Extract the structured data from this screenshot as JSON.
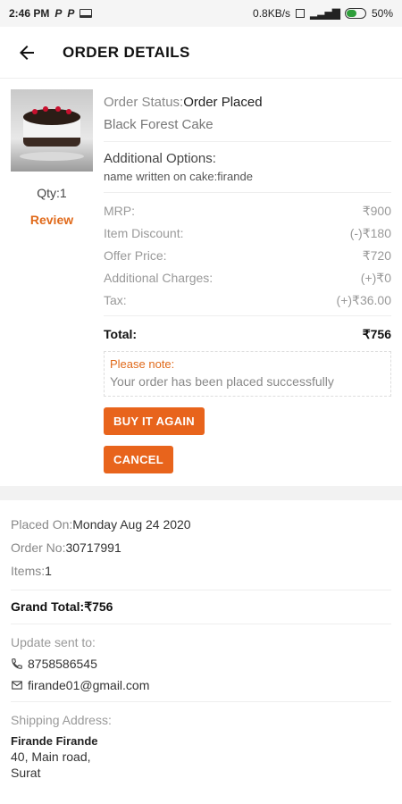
{
  "status_bar": {
    "time": "2:46 PM",
    "p1": "P",
    "p2": "P",
    "network_speed": "0.8KB/s",
    "battery_pct": "50%"
  },
  "header": {
    "title": "ORDER DETAILS"
  },
  "item": {
    "qty_text": "Qty:1",
    "review_label": "Review",
    "status_label": "Order Status:",
    "status_value": "Order Placed",
    "name": "Black Forest Cake",
    "options_title": "Additional Options:",
    "options_value": "name written on cake:firande"
  },
  "prices": {
    "rows": [
      {
        "label": "MRP:",
        "value": "₹900"
      },
      {
        "label": "Item Discount:",
        "value": "(-)₹180"
      },
      {
        "label": "Offer Price:",
        "value": "₹720"
      },
      {
        "label": "Additional Charges:",
        "value": "(+)₹0"
      },
      {
        "label": "Tax:",
        "value": "(+)₹36.00"
      }
    ],
    "total_label": "Total:",
    "total_value": "₹756"
  },
  "note": {
    "title": "Please note:",
    "text": "Your order has been placed successfully"
  },
  "buttons": {
    "buy_again": "BUY IT AGAIN",
    "cancel": "CANCEL"
  },
  "summary": {
    "placed_label": "Placed On:",
    "placed_value": "Monday Aug 24 2020",
    "order_label": "Order No:",
    "order_value": "30717991",
    "items_label": "Items:",
    "items_value": "1",
    "grand_label": "Grand Total:",
    "grand_value": "₹756"
  },
  "contact": {
    "title": "Update sent to:",
    "phone": "8758586545",
    "email": "firande01@gmail.com"
  },
  "shipping": {
    "title": "Shipping Address:",
    "name": "Firande Firande",
    "line1": "40, Main road,",
    "line2": "Surat"
  },
  "colors": {
    "accent": "#e8641c",
    "link": "#e06a1b"
  }
}
